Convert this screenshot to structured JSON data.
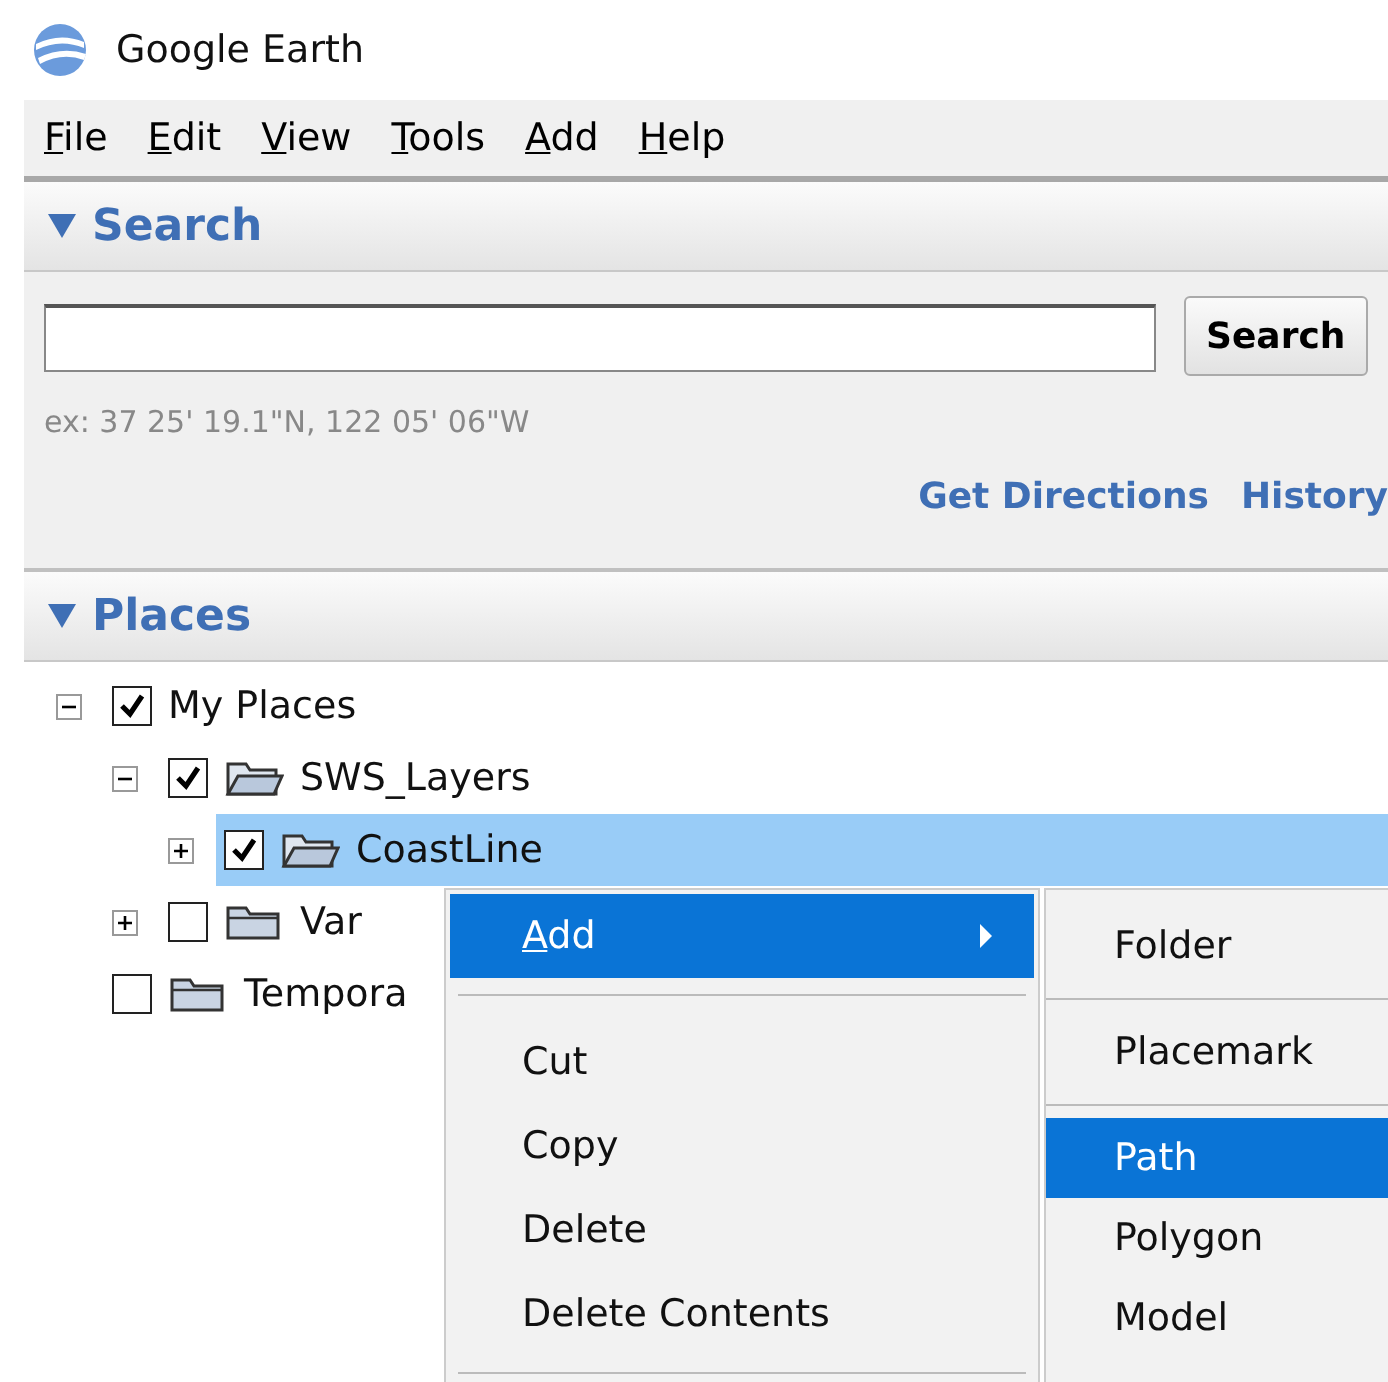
{
  "window": {
    "title": "Google Earth"
  },
  "menu_bar": [
    {
      "label": "File"
    },
    {
      "label": "Edit"
    },
    {
      "label": "View"
    },
    {
      "label": "Tools"
    },
    {
      "label": "Add"
    },
    {
      "label": "Help"
    }
  ],
  "search_panel": {
    "header": "Search",
    "expanded": true,
    "button": "Search",
    "hint": "ex: 37 25' 19.1\"N, 122 05' 06\"W",
    "links": [
      "Get Directions",
      "History"
    ]
  },
  "places_panel": {
    "header": "Places",
    "expanded": true,
    "tree": [
      {
        "label": "My Places",
        "kind": "root",
        "checked": true,
        "expanded": true,
        "selected": false,
        "children": [
          {
            "label": "SWS_Layers",
            "kind": "folder",
            "open": true,
            "checked": true,
            "expanded": true,
            "selected": false,
            "children": [
              {
                "label": "CoastLine",
                "kind": "folder",
                "open": true,
                "checked": true,
                "expanded": false,
                "selected": true
              }
            ]
          },
          {
            "label": "Var",
            "kind": "folder",
            "open": false,
            "checked": false,
            "expanded": false,
            "selected": false
          }
        ]
      },
      {
        "label": "Tempora",
        "kind": "folder",
        "open": false,
        "checked": false,
        "selected": false
      }
    ]
  },
  "context_menu": [
    {
      "kind": "submenu",
      "label": "Add",
      "mnemonic": true,
      "selected": true
    },
    {
      "kind": "separator"
    },
    {
      "kind": "item",
      "label": "Cut",
      "mnemonic": false,
      "selected": false
    },
    {
      "kind": "item",
      "label": "Copy",
      "mnemonic": false,
      "selected": false
    },
    {
      "kind": "item",
      "label": "Delete",
      "mnemonic": false,
      "selected": false
    },
    {
      "kind": "item",
      "label": "Delete Contents",
      "mnemonic": false,
      "selected": false
    },
    {
      "kind": "separator"
    }
  ],
  "submenu": [
    {
      "kind": "item",
      "label": "Folder",
      "selected": false
    },
    {
      "kind": "separator"
    },
    {
      "kind": "item",
      "label": "Placemark",
      "selected": false
    },
    {
      "kind": "separator"
    },
    {
      "kind": "item",
      "label": "Path",
      "selected": true
    },
    {
      "kind": "item",
      "label": "Polygon",
      "selected": false
    },
    {
      "kind": "item",
      "label": "Model",
      "selected": false
    }
  ]
}
